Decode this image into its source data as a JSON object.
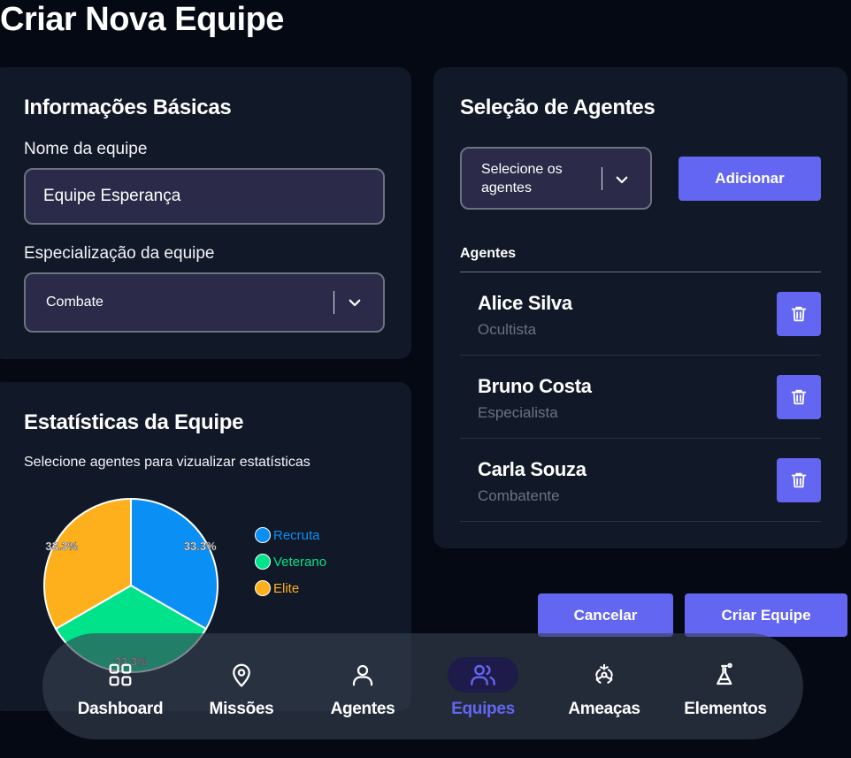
{
  "page": {
    "title": "Criar Nova Equipe"
  },
  "basic_info": {
    "title": "Informações Básicas",
    "name_label": "Nome da equipe",
    "name_value": "Equipe Esperança",
    "spec_label": "Especialização da equipe",
    "spec_value": "Combate"
  },
  "stats": {
    "title": "Estatísticas da Equipe",
    "subtitle": "Selecione agentes para vizualizar estatísticas",
    "chart_data": {
      "type": "pie",
      "categories": [
        "Recruta",
        "Veterano",
        "Elite"
      ],
      "values": [
        33.3,
        33.3,
        33.3
      ],
      "labels": [
        "33.3%",
        "33.3%",
        "33.3%"
      ],
      "colors": [
        "#0a8ff5",
        "#00e38b",
        "#fdb01c"
      ],
      "legend": "right"
    }
  },
  "agents_panel": {
    "title": "Seleção de Agentes",
    "select_placeholder": "Selecione os agentes",
    "add_label": "Adicionar",
    "list_header": "Agentes",
    "agents": [
      {
        "name": "Alice Silva",
        "role": "Ocultista"
      },
      {
        "name": "Bruno Costa",
        "role": "Especialista"
      },
      {
        "name": "Carla Souza",
        "role": "Combatente"
      }
    ]
  },
  "actions": {
    "cancel_label": "Cancelar",
    "create_label": "Criar Equipe"
  },
  "nav": {
    "items": [
      {
        "label": "Dashboard",
        "icon": "grid-icon"
      },
      {
        "label": "Missões",
        "icon": "map-pin-icon"
      },
      {
        "label": "Agentes",
        "icon": "user-icon"
      },
      {
        "label": "Equipes",
        "icon": "users-icon",
        "active": true
      },
      {
        "label": "Ameaças",
        "icon": "biohazard-icon"
      },
      {
        "label": "Elementos",
        "icon": "flask-icon"
      }
    ]
  },
  "colors": {
    "accent": "#6366f1",
    "background": "#050914",
    "card": "#111827"
  }
}
